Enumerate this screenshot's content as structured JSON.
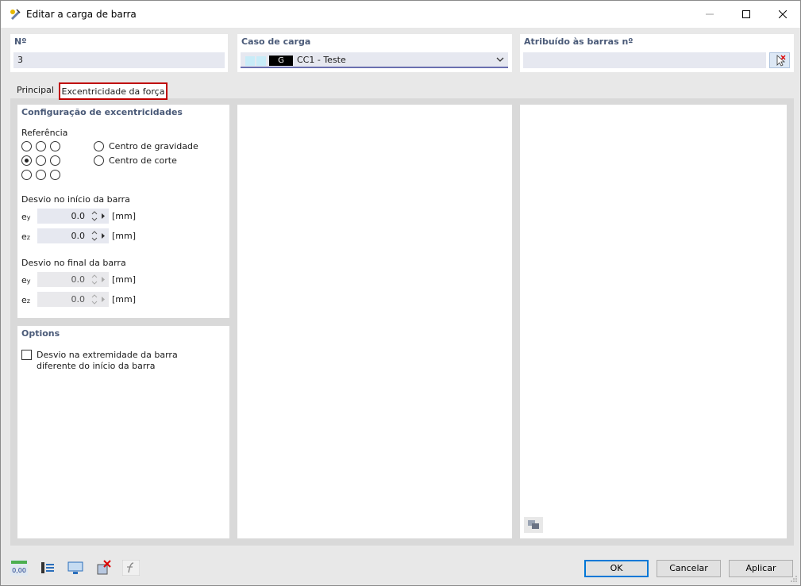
{
  "window": {
    "title": "Editar a carga de barra"
  },
  "fields": {
    "number": {
      "label": "Nº",
      "value": "3"
    },
    "load_case": {
      "label": "Caso de carga",
      "badge": "G",
      "value": "CC1 - Teste",
      "swatch_colors": [
        "#c8ecf8",
        "#c8ecf8"
      ]
    },
    "assigned": {
      "label": "Atribuído às barras nº",
      "value": ""
    }
  },
  "tabs": [
    {
      "label": "Principal"
    },
    {
      "label": "Excentricidade da força"
    }
  ],
  "ecc": {
    "title": "Configuração de excentricidades",
    "reference_label": "Referência",
    "center_gravity": "Centro de gravidade",
    "center_shear": "Centro de corte",
    "start_title": "Desvio no início da barra",
    "end_title": "Desvio no final da barra",
    "ey_start": "0.0",
    "ez_start": "0.0",
    "ey_end": "0.0",
    "ez_end": "0.0",
    "unit": "[mm]",
    "e_letter": "e",
    "y": "y",
    "z": "z"
  },
  "options": {
    "title": "Options",
    "checkbox_line1": "Desvio na extremidade da barra",
    "checkbox_line2": "diferente do início da barra"
  },
  "buttons": {
    "ok": "OK",
    "cancel": "Cancelar",
    "apply": "Aplicar"
  },
  "toolbar": {
    "value_icon_text": "0,00"
  },
  "colors": {
    "accent": "#0078d7",
    "label_blue": "#4a5a78",
    "highlight": "#c00000"
  }
}
